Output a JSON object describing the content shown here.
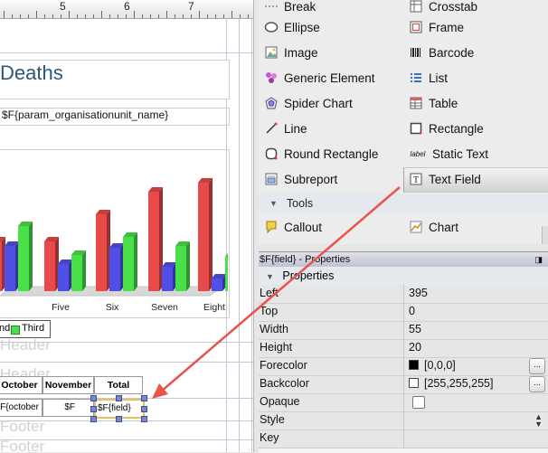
{
  "ruler": {
    "numbers": [
      "5",
      "6",
      "7"
    ]
  },
  "report": {
    "title": "Deaths",
    "param_field": "$F{param_organisationunit_name}",
    "bands": [
      "Header",
      "Header",
      "Footer",
      "Footer"
    ]
  },
  "chart_data": {
    "type": "bar",
    "categories": [
      "",
      "Five",
      "Six",
      "Seven",
      "Eight"
    ],
    "series": [
      {
        "name": "",
        "values": [
          55,
          55,
          85,
          110,
          120
        ],
        "color": "#e84a4a"
      },
      {
        "name": "",
        "values": [
          50,
          30,
          48,
          27,
          14
        ],
        "color": "#5050e8"
      },
      {
        "name": "Third",
        "values": [
          72,
          40,
          60,
          50,
          38
        ],
        "color": "#4ae04a"
      }
    ],
    "legend_partial": "nd"
  },
  "table": {
    "headers": [
      "October",
      "November",
      "Total"
    ],
    "cells": [
      "F{october",
      "$F",
      "$F{field}"
    ]
  },
  "palette": {
    "items": [
      {
        "label": "Break",
        "icon": "break-icon"
      },
      {
        "label": "Crosstab",
        "icon": "crosstab-icon"
      },
      {
        "label": "Ellipse",
        "icon": "ellipse-icon"
      },
      {
        "label": "Frame",
        "icon": "frame-icon"
      },
      {
        "label": "Image",
        "icon": "image-icon"
      },
      {
        "label": "Barcode",
        "icon": "barcode-icon"
      },
      {
        "label": "Generic Element",
        "icon": "generic-element-icon"
      },
      {
        "label": "List",
        "icon": "list-icon"
      },
      {
        "label": "Spider Chart",
        "icon": "spider-chart-icon"
      },
      {
        "label": "Table",
        "icon": "table-icon"
      },
      {
        "label": "Line",
        "icon": "line-icon"
      },
      {
        "label": "Rectangle",
        "icon": "rectangle-icon"
      },
      {
        "label": "Round Rectangle",
        "icon": "round-rectangle-icon"
      },
      {
        "label": "Static Text",
        "icon": "static-text-icon"
      },
      {
        "label": "Subreport",
        "icon": "subreport-icon"
      },
      {
        "label": "Text Field",
        "icon": "text-field-icon"
      }
    ],
    "tools_group": "Tools",
    "tools": [
      {
        "label": "Callout",
        "icon": "callout-icon"
      },
      {
        "label": "Chart",
        "icon": "chart-icon"
      }
    ]
  },
  "properties": {
    "title": "$F{field} - Properties",
    "section": "Properties",
    "rows": [
      {
        "name": "Left",
        "value": "395"
      },
      {
        "name": "Top",
        "value": "0"
      },
      {
        "name": "Width",
        "value": "55"
      },
      {
        "name": "Height",
        "value": "20"
      },
      {
        "name": "Forecolor",
        "value": "[0,0,0]",
        "swatch": "#000000"
      },
      {
        "name": "Backcolor",
        "value": "[255,255,255]",
        "swatch": "#ffffff"
      },
      {
        "name": "Opaque",
        "value": ""
      },
      {
        "name": "Style",
        "value": ""
      },
      {
        "name": "Key",
        "value": ""
      }
    ]
  },
  "colors": {
    "accent_arrow": "#e8544a",
    "title_blue": "#2d5777"
  }
}
